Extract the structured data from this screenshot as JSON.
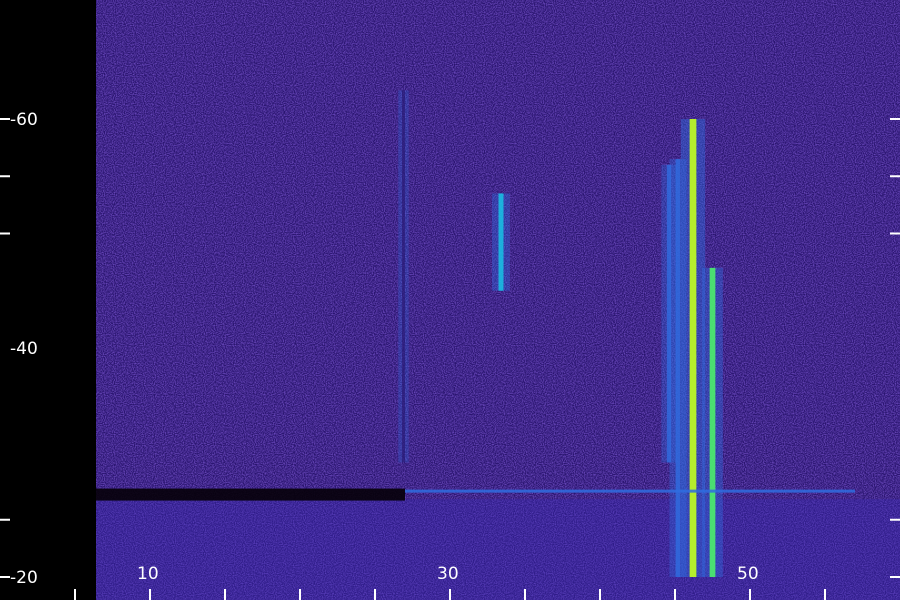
{
  "chart_data": {
    "type": "heatmap",
    "title": "",
    "xlabel": "",
    "ylabel": "",
    "xlim": [
      4,
      57
    ],
    "ylim": [
      -20,
      65
    ],
    "x_ticks": [
      5,
      10,
      15,
      20,
      25,
      30,
      35,
      40,
      45,
      50,
      55
    ],
    "x_tick_labels": [
      {
        "value": 10,
        "text": "10"
      },
      {
        "value": 30,
        "text": "30"
      },
      {
        "value": 50,
        "text": "50"
      }
    ],
    "y_ticks": [
      -20,
      -10,
      40,
      50,
      60
    ],
    "y_tick_labels": [
      {
        "value": 60,
        "text": "-60"
      },
      {
        "value": 40,
        "text": "-40"
      },
      {
        "value": -20,
        "text": "-20"
      }
    ],
    "colorscale": [
      "#1a0a3a",
      "#2a1570",
      "#3a2ab8",
      "#2f6de0",
      "#17c6e6",
      "#4df06a",
      "#b8f22a"
    ],
    "features": [
      {
        "kind": "vertical-line",
        "x": 46.2,
        "y_from": -20,
        "y_to": 60,
        "intensity": 0.95
      },
      {
        "kind": "vertical-line",
        "x": 45.2,
        "y_from": -20,
        "y_to": 53,
        "intensity": 0.55
      },
      {
        "kind": "vertical-line",
        "x": 44.6,
        "y_from": 0,
        "y_to": 52,
        "intensity": 0.45
      },
      {
        "kind": "vertical-line",
        "x": 47.5,
        "y_from": -20,
        "y_to": 34,
        "intensity": 0.75
      },
      {
        "kind": "vertical-line",
        "x": 33.4,
        "y_from": 30,
        "y_to": 47,
        "intensity": 0.6
      },
      {
        "kind": "vertical-line",
        "x": 26.9,
        "y_from": 0,
        "y_to": 65,
        "intensity": 0.18
      },
      {
        "kind": "horizontal-line",
        "y": -5,
        "x_from": 27,
        "x_to": 57,
        "intensity": 0.5
      },
      {
        "kind": "dark-band",
        "y": -5.6,
        "x_from": 4,
        "x_to": 27
      }
    ]
  }
}
